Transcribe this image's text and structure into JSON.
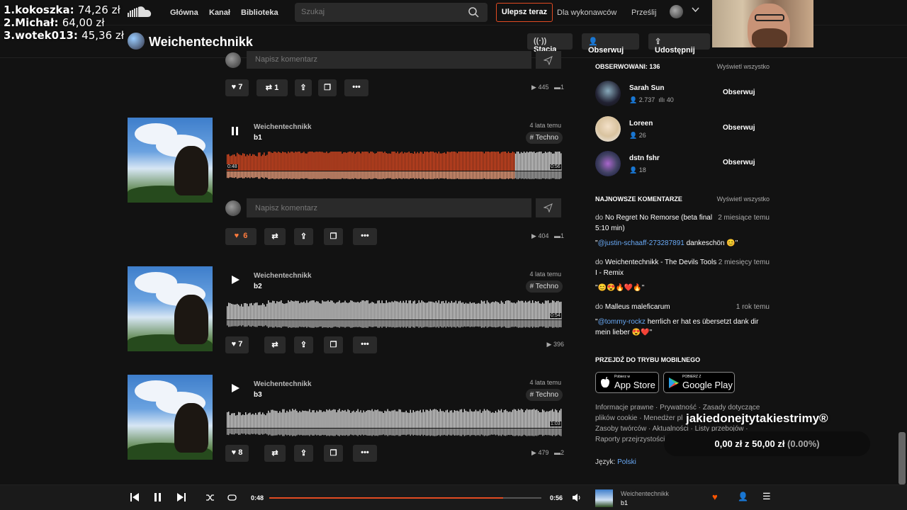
{
  "nav": {
    "links": [
      "Główna",
      "Kanał",
      "Biblioteka"
    ],
    "search_placeholder": "Szukaj",
    "upgrade": "Ulepsz teraz",
    "for_artists": "Dla wykonawców",
    "upload": "Prześlij"
  },
  "overlay": {
    "leaderboard": [
      {
        "rank": "1.",
        "name": "kokoszka:",
        "amount": "74,26 zł"
      },
      {
        "rank": "2.",
        "name": "Michał:",
        "amount": "64,00 zł"
      },
      {
        "rank": "3.",
        "name": "wotek013:",
        "amount": "45,36 zł"
      }
    ],
    "donate_title": "jakiedonejtytakiestrimy®",
    "donate_current": "0,00 zł",
    "donate_of": "z",
    "donate_goal": "50,00 zł",
    "donate_pct": "(0.00%)"
  },
  "header": {
    "title": "Weichentechnikk",
    "station": "Stacja",
    "follow": "Obserwuj",
    "share": "Udostępnij"
  },
  "comment_placeholder": "Napisz komentarz",
  "tracks": [
    {
      "likes": "7",
      "reposts": "1",
      "plays": "445",
      "comments": "1"
    },
    {
      "user": "Weichentechnikk",
      "title": "b1",
      "ago": "4 lata temu",
      "tag": "# Techno",
      "time_left": "0:48",
      "time_right": "0:56",
      "progress": 0.86,
      "playing": true,
      "likes": "6",
      "plays": "404",
      "comments": "1"
    },
    {
      "user": "Weichentechnikk",
      "title": "b2",
      "ago": "4 lata temu",
      "tag": "# Techno",
      "time_right": "0:54",
      "likes": "7",
      "plays": "396"
    },
    {
      "user": "Weichentechnikk",
      "title": "b3",
      "ago": "4 lata temu",
      "tag": "# Techno",
      "time_right": "1:03",
      "likes": "8",
      "plays": "479",
      "comments": "2"
    }
  ],
  "sidebar": {
    "following_title": "OBSERWOWANI: 136",
    "see_all": "Wyświetl wszystko",
    "following": [
      {
        "name": "Sarah Sun",
        "followers": "2.737",
        "tracks": "40",
        "button": "Obserwuj"
      },
      {
        "name": "Loreen",
        "followers": "26",
        "button": "Obserwuj"
      },
      {
        "name": "dstn fshr",
        "followers": "18",
        "button": "Obserwuj"
      }
    ],
    "comments_title": "NAJNOWSZE KOMENTARZE",
    "comments": [
      {
        "prefix": "do",
        "track_a": "No Regret No Remorse (beta final",
        "when": "2 miesiące temu",
        "track_b": "5:10 min)",
        "q_open": "\"",
        "mention": "@justin-schaaff-273287891",
        "text": " dankeschön 😊\""
      },
      {
        "prefix": "do",
        "track_a": "Weichentechnikk - The Devils Tools",
        "when": "2 miesięcy temu",
        "track_b": "I - Remix",
        "emoji": "\"😊😍🔥❤️🔥\""
      },
      {
        "prefix": "do",
        "track_a": "Malleus maleficarum",
        "when": "1 rok temu",
        "q_open": "\"",
        "mention": "@tommy-rockz",
        "text": " herrlich er hat es übersetzt dank dir",
        "text2": "mein lieber 😍❤️\""
      }
    ],
    "mobile_title": "PRZEJDŹ DO TRYBU MOBILNEGO",
    "appstore_small": "Pobierz w",
    "appstore": "App Store",
    "gplay_small": "POBIERZ Z",
    "gplay": "Google Play",
    "footer1": "Informacje prawne · Prywatność · Zasady dotyczące",
    "footer2": "plików cookie · Menedżer pl",
    "footer3": "Zasoby twórców · Aktualności · Listy przebojów ·",
    "footer4": "Raporty przejrzystości",
    "lang_label": "Język:",
    "lang_value": "Polski"
  },
  "player": {
    "current": "0:48",
    "total": "0:56",
    "progress": 0.86,
    "user": "Weichentechnikk",
    "title": "b1"
  }
}
